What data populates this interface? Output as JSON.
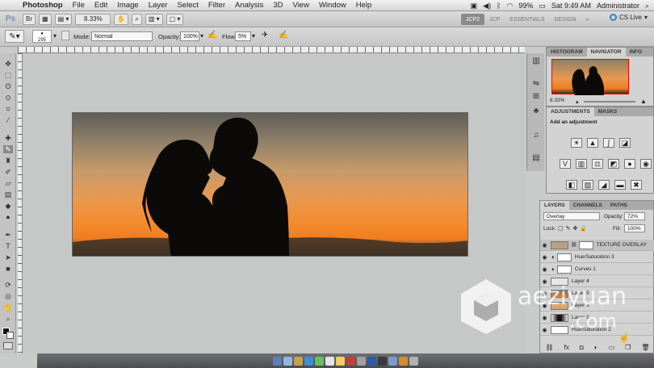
{
  "menubar": {
    "app_name": "Photoshop",
    "items": [
      "File",
      "Edit",
      "Image",
      "Layer",
      "Select",
      "Filter",
      "Analysis",
      "3D",
      "View",
      "Window",
      "Help"
    ],
    "battery": "99%",
    "clock": "Sat 9:49 AM",
    "user": "Administrator"
  },
  "appbar": {
    "logo": "Ps",
    "zoom": "8.33%",
    "workspaces": [
      "JCP2",
      "JCP",
      "ESSENTIALS",
      "DESIGN"
    ],
    "workspace_more": "»",
    "cs_live": "CS Live"
  },
  "options": {
    "brush_size": "295",
    "mode_label": "Mode:",
    "mode_value": "Normal",
    "opacity_label": "Opacity:",
    "opacity_value": "100%",
    "flow_label": "Flow:",
    "flow_value": "5%"
  },
  "navigator": {
    "tabs": [
      "HISTOGRAM",
      "NAVIGATOR",
      "INFO"
    ],
    "zoom": "8.33%"
  },
  "adjustments": {
    "tabs": [
      "ADJUSTMENTS",
      "MASKS"
    ],
    "title": "Add an adjustment"
  },
  "layers": {
    "tabs": [
      "LAYERS",
      "CHANNELS",
      "PATHS"
    ],
    "blend_mode": "Overlay",
    "opacity_label": "Opacity:",
    "opacity_value": "72%",
    "lock_label": "Lock:",
    "fill_label": "Fill:",
    "fill_value": "100%",
    "items": [
      {
        "name": "TEXTURE OVERLAY"
      },
      {
        "name": "Hue/Saturation 3"
      },
      {
        "name": "Curves 1"
      },
      {
        "name": "Layer 4"
      },
      {
        "name": "Layer 5"
      },
      {
        "name": "Layer 3"
      },
      {
        "name": "Layer 2"
      },
      {
        "name": "Hue/Saturation 2"
      }
    ]
  },
  "watermark": {
    "line1": "aeziyuan",
    "line2": ".com"
  },
  "colors": {
    "sunset_orange": "#f07c22",
    "workspace_active": "#8a8a8a"
  }
}
